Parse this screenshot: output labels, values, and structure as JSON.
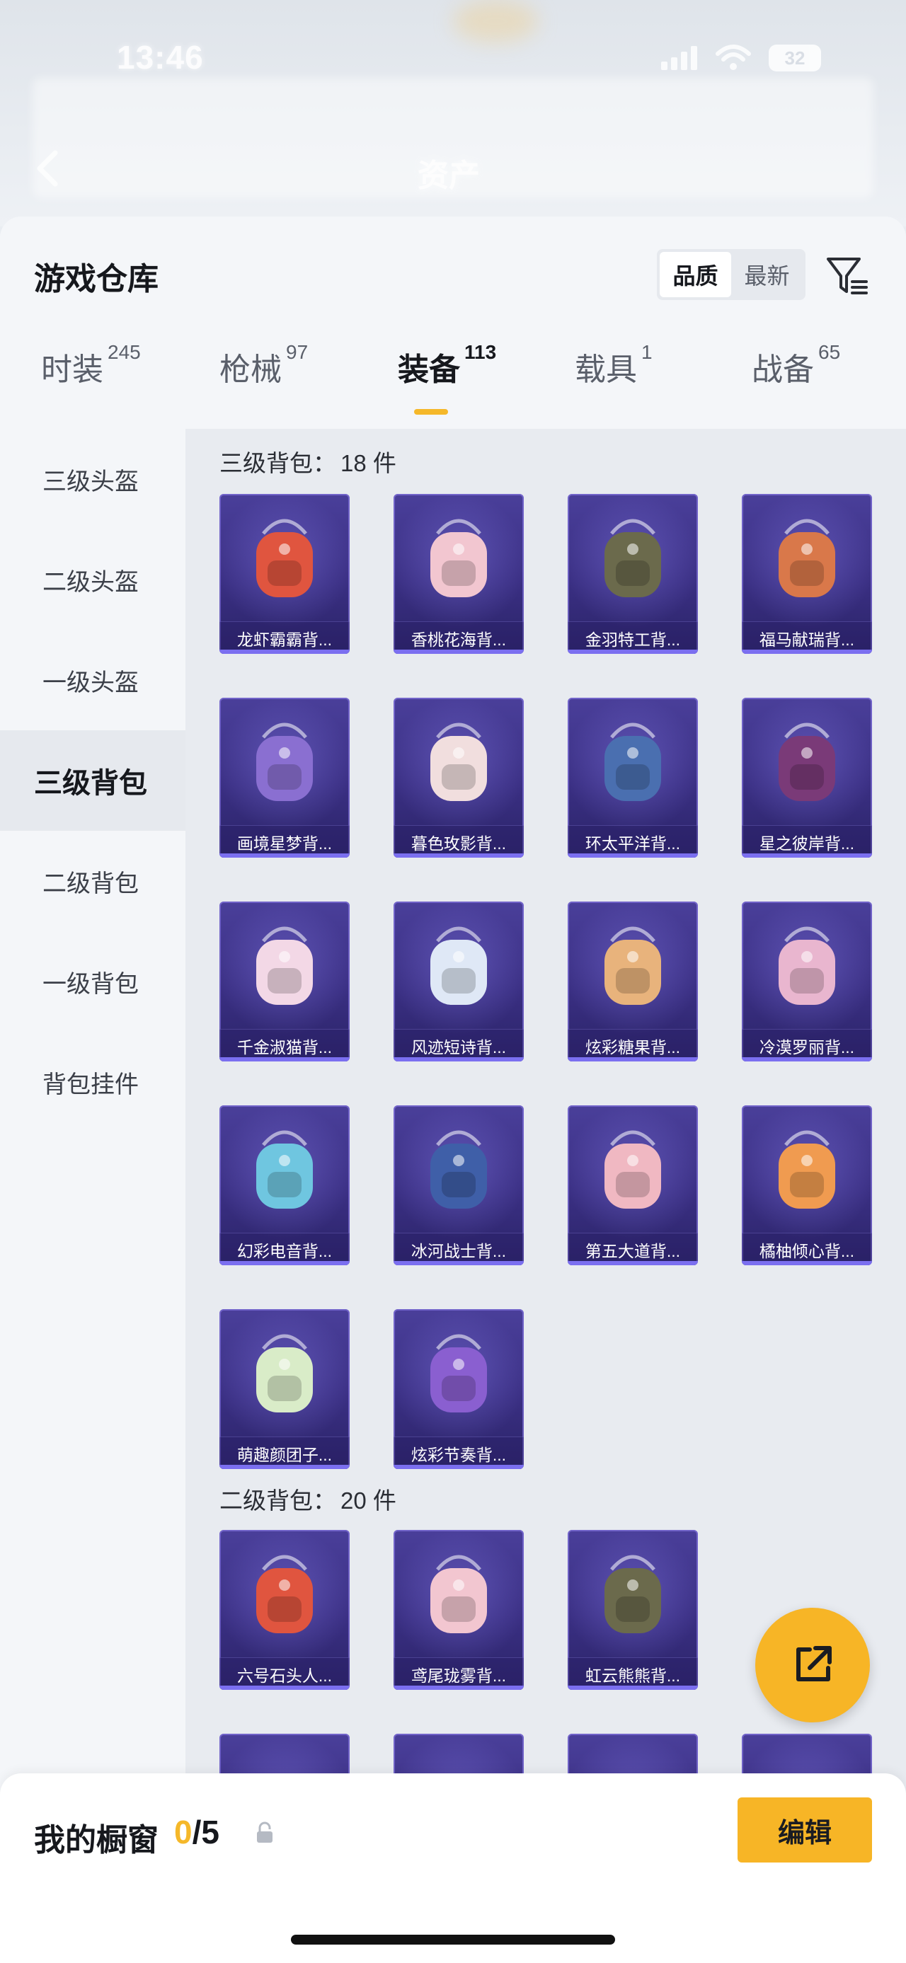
{
  "status_bar": {
    "time": "13:46",
    "battery": "32"
  },
  "nav": {
    "title": "资产"
  },
  "header": {
    "title": "游戏仓库",
    "sort": [
      "品质",
      "最新"
    ]
  },
  "tabs": [
    {
      "label": "时装",
      "count": "245"
    },
    {
      "label": "枪械",
      "count": "97"
    },
    {
      "label": "装备",
      "count": "113"
    },
    {
      "label": "载具",
      "count": "1"
    },
    {
      "label": "战备",
      "count": "65"
    }
  ],
  "sidebar": {
    "items": [
      "三级头盔",
      "二级头盔",
      "一级头盔",
      "三级背包",
      "二级背包",
      "一级背包",
      "背包挂件"
    ]
  },
  "sections": [
    {
      "title": "三级背包：",
      "count": "18 件",
      "items": [
        "龙虾霸霸背...",
        "香桃花海背...",
        "金羽特工背...",
        "福马献瑞背...",
        "画境星梦背...",
        "暮色玫影背...",
        "环太平洋背...",
        "星之彼岸背...",
        "千金淑猫背...",
        "风迹短诗背...",
        "炫彩糖果背...",
        "冷漠罗丽背...",
        "幻彩电音背...",
        "冰河战士背...",
        "第五大道背...",
        "橘柚倾心背...",
        "萌趣颜团子...",
        "炫彩节奏背..."
      ]
    },
    {
      "title": "二级背包：",
      "count": "20 件",
      "items": [
        "六号石头人...",
        "鸢尾珑雾背...",
        "虹云熊熊背..."
      ]
    }
  ],
  "bottom": {
    "title": "我的橱窗",
    "current": "0",
    "total": "/5",
    "edit_label": "编辑"
  },
  "colors": {
    "accent": "#f5b82a",
    "card": "#3a2f83"
  },
  "icons": [
    "signal-icon",
    "wifi-icon",
    "battery-icon",
    "back-arrow-icon",
    "filter-icon",
    "share-external-icon",
    "lock-icon"
  ]
}
